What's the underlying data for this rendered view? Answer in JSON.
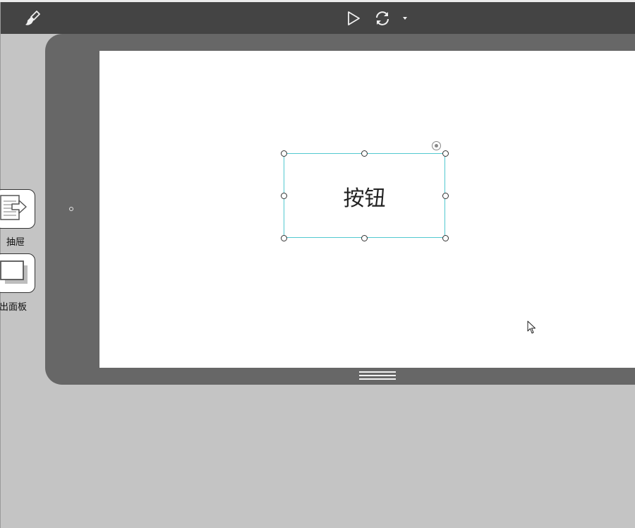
{
  "toolbar": {
    "icons": {
      "brush": "brush-icon",
      "play": "play-icon",
      "refresh": "refresh-icon",
      "caret": "chevron-down-icon"
    }
  },
  "canvas": {
    "button_widget": {
      "label": "按钮"
    }
  },
  "side_panel": {
    "items": [
      {
        "label": "抽屉",
        "icon": "drawer-icon"
      },
      {
        "label": "弹出面板",
        "icon": "popup-panel-icon"
      }
    ]
  },
  "colors": {
    "toolbar_bg": "#444444",
    "workspace_bg": "#c4c4c4",
    "tablet_bezel": "#676767",
    "selection_border": "#52c9d0"
  }
}
